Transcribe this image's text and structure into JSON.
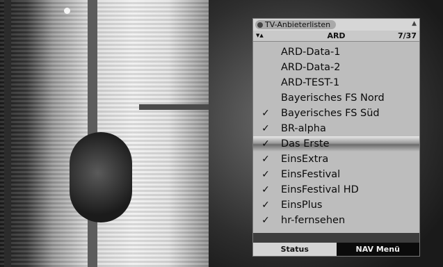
{
  "menu": {
    "title": "TV-Anbieterlisten",
    "category": "ARD",
    "position": "7/37",
    "items": [
      {
        "label": "ARD-Data-1",
        "checked": false,
        "selected": false
      },
      {
        "label": "ARD-Data-2",
        "checked": false,
        "selected": false
      },
      {
        "label": "ARD-TEST-1",
        "checked": false,
        "selected": false
      },
      {
        "label": "Bayerisches FS Nord",
        "checked": false,
        "selected": false
      },
      {
        "label": "Bayerisches FS Süd",
        "checked": true,
        "selected": false
      },
      {
        "label": "BR-alpha",
        "checked": true,
        "selected": false
      },
      {
        "label": "Das Erste",
        "checked": true,
        "selected": true
      },
      {
        "label": "EinsExtra",
        "checked": true,
        "selected": false
      },
      {
        "label": "EinsFestival",
        "checked": true,
        "selected": false
      },
      {
        "label": "EinsFestival HD",
        "checked": true,
        "selected": false
      },
      {
        "label": "EinsPlus",
        "checked": true,
        "selected": false
      },
      {
        "label": "hr-fernsehen",
        "checked": true,
        "selected": false
      }
    ],
    "check_glyph": "✓"
  },
  "softkeys": {
    "status": "Status",
    "nav_menu": "NAV Menü"
  },
  "icons": {
    "title_icon": "disc-icon",
    "scroll_icon": "up-down-arrows-icon"
  }
}
